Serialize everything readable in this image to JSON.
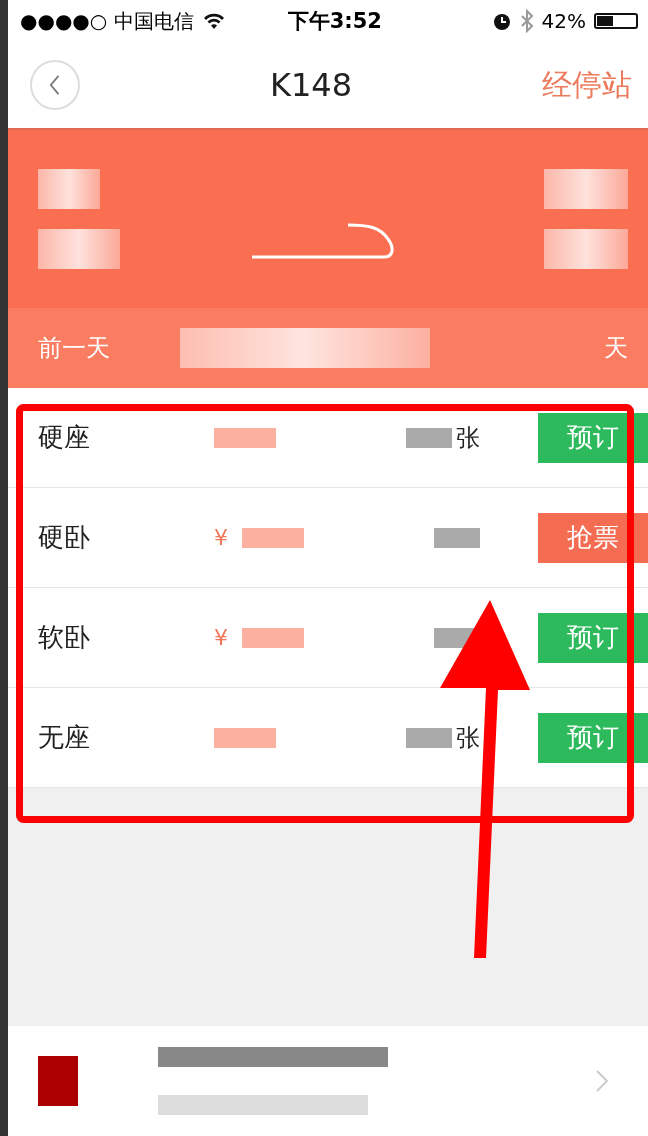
{
  "status_bar": {
    "carrier": "●●●●○ 中国电信",
    "time": "下午3:52",
    "battery": "42%"
  },
  "nav": {
    "title": "K148",
    "action": "经停站"
  },
  "date_bar": {
    "previous": "前一天",
    "next_fragment": "天"
  },
  "seats": [
    {
      "name": "硬座",
      "count_suffix": "张",
      "action": {
        "label": "预订",
        "kind": "book"
      }
    },
    {
      "name": "硬卧",
      "price_prefix": "¥",
      "action": {
        "label": "抢票",
        "kind": "grab"
      }
    },
    {
      "name": "软卧",
      "price_prefix": "¥",
      "action": {
        "label": "预订",
        "kind": "book"
      }
    },
    {
      "name": "无座",
      "count_suffix": "张",
      "action": {
        "label": "预订",
        "kind": "book"
      }
    }
  ]
}
